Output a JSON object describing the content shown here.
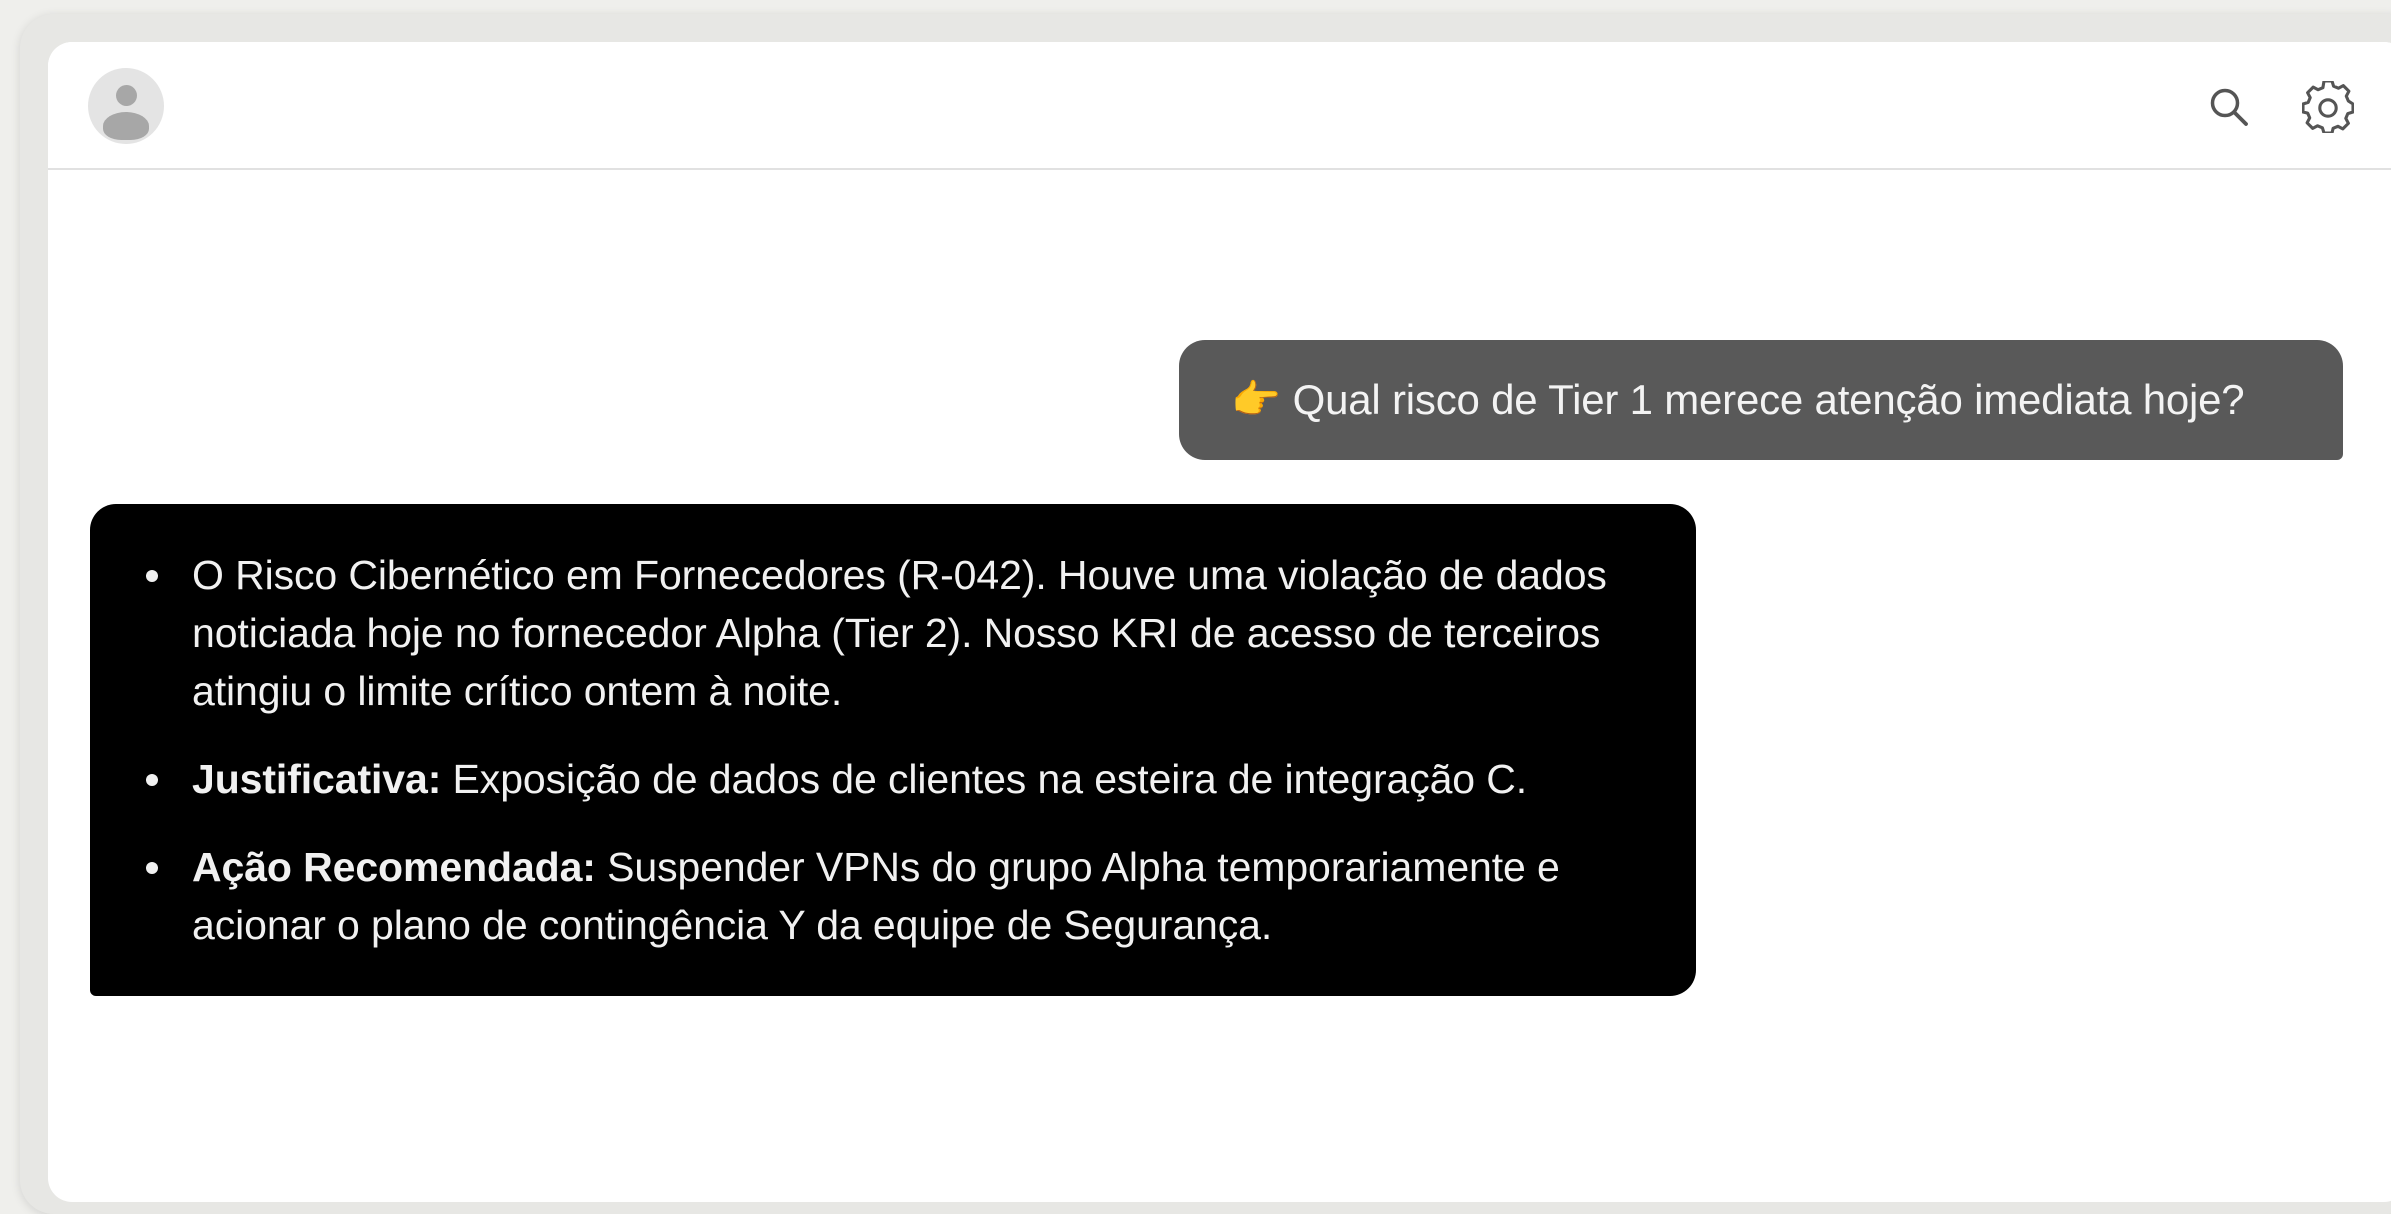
{
  "icons": {
    "avatar": "user-avatar",
    "search": "search-icon",
    "settings": "gear-icon"
  },
  "chat": {
    "user_message": {
      "emoji": "👉",
      "text": "Qual risco de Tier 1 merece atenção imediata hoje?"
    },
    "assistant_message": {
      "items": [
        {
          "prefix": "",
          "text": "O Risco Cibernético em Fornecedores (R-042). Houve uma violação de dados noticiada hoje no fornecedor Alpha (Tier 2). Nosso KRI de acesso de terceiros atingiu o limite crítico ontem à noite."
        },
        {
          "prefix": "Justificativa:",
          "text": " Exposição de dados de clientes na esteira de integração C."
        },
        {
          "prefix": "Ação Recomendada:",
          "text": " Suspender VPNs do grupo Alpha temporariamente e acionar o plano de contingência Y da equipe de Segurança."
        }
      ]
    }
  },
  "colors": {
    "page_background": "#efefec",
    "window_background": "#ffffff",
    "user_bubble": "#595959",
    "assistant_bubble": "#000000",
    "assistant_text": "#f1f1f1",
    "icon_stroke": "#555555"
  }
}
